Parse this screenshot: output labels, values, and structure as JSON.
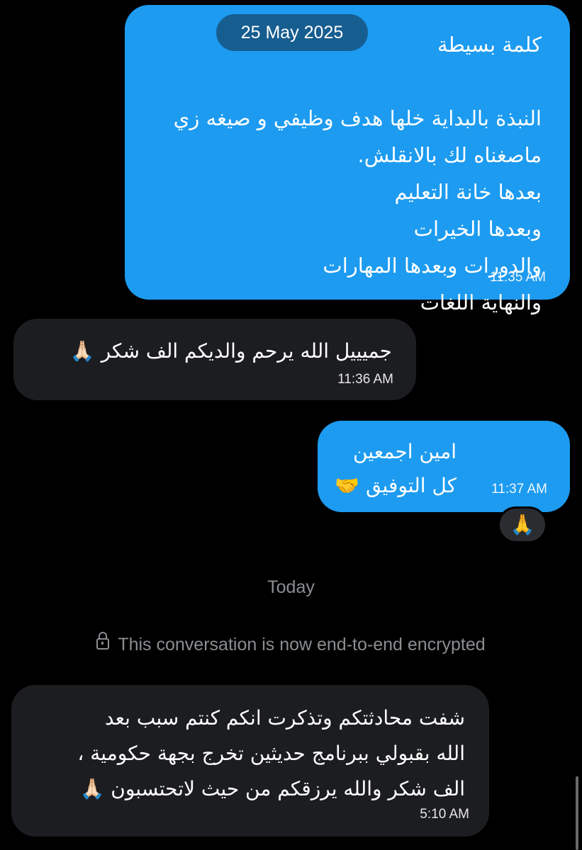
{
  "conversation": {
    "date_pill": "25 May 2025",
    "messages": [
      {
        "direction": "outgoing",
        "text": "كلمة بسيطة\n\nالنبذة بالبداية خلها هدف وظيفي و صيغه زي\nماصغناه لك بالانقلش.\nبعدها خانة التعليم\nوبعدها الخيرات\nوالدورات وبعدها المهارات\nوالنهاية اللغات",
        "time": "11:35 AM"
      },
      {
        "direction": "incoming",
        "text": "جميييل الله يرحم والديكم الف شكر 🙏🏻",
        "time": "11:36 AM"
      },
      {
        "direction": "outgoing",
        "text": "امين اجمعين\nكل التوفيق 🤝",
        "time": "11:37 AM",
        "reaction": "🙏"
      },
      {
        "direction": "incoming",
        "text": "شفت محادثتكم وتذكرت انكم كنتم سبب بعد\nالله بقبولي ببرنامج حديثين تخرج بجهة حكومية ،\nالف شكر والله يرزقكم من حيث لاتحتسبون 🙏🏻",
        "time": "5:10 AM"
      }
    ],
    "separator_today": "Today",
    "encryption_notice": "This conversation is now end-to-end encrypted",
    "encryption_icon": "lock-icon"
  },
  "colors": {
    "background": "#000000",
    "outgoing_bubble": "#1d9bf0",
    "incoming_bubble": "#1c1d20",
    "muted_text": "#8a8d91"
  }
}
